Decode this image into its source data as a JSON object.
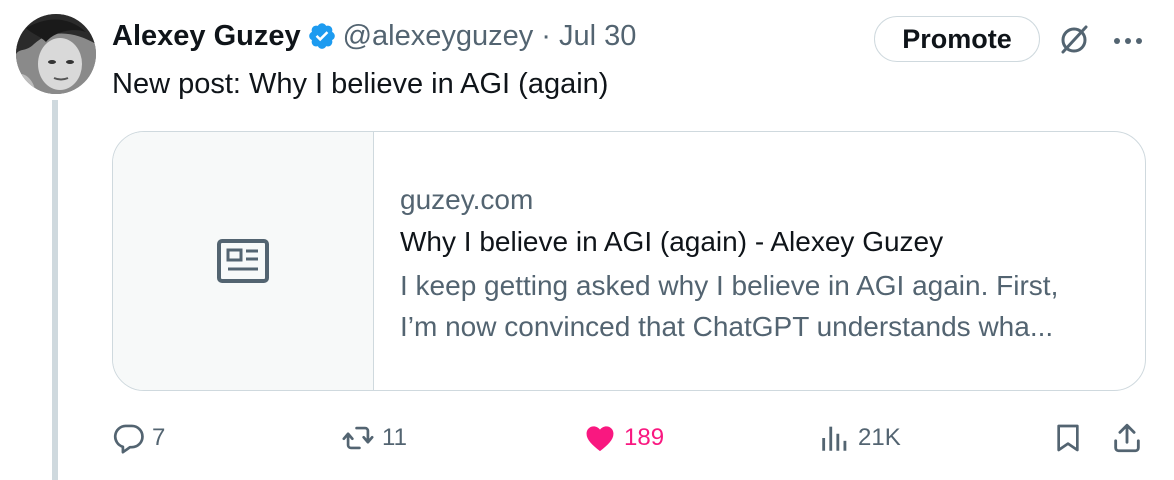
{
  "tweet": {
    "author_name": "Alexey Guzey",
    "handle": "@alexeyguzey",
    "separator": "·",
    "date": "Jul 30",
    "promote_label": "Promote",
    "text": "New post: Why I believe in AGI (again)",
    "verified_color": "#1d9bf0"
  },
  "card": {
    "domain": "guzey.com",
    "title": "Why I believe in AGI (again) - Alexey Guzey",
    "description_line1": "I keep getting asked why I believe in AGI again. First,",
    "description_line2": "I’m now convinced that ChatGPT understands wha...",
    "icon": "article-icon"
  },
  "actions": {
    "replies": "7",
    "reposts": "11",
    "likes": "189",
    "views": "21K",
    "like_color": "#f91880"
  }
}
